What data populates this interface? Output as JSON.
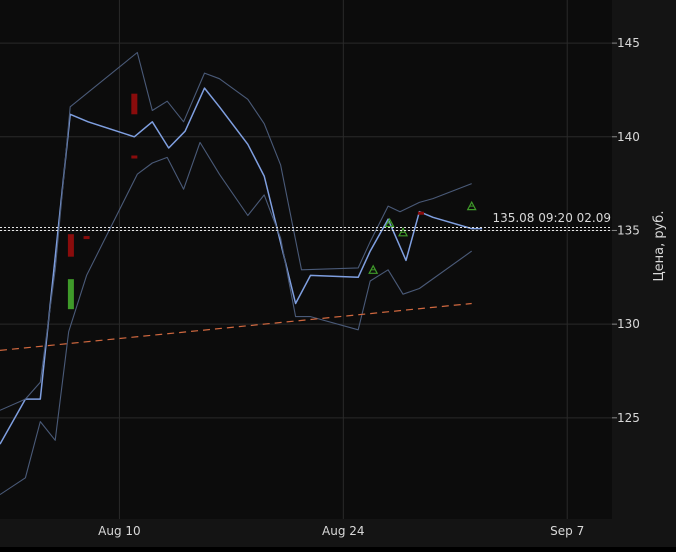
{
  "chart_data": {
    "type": "line",
    "ylabel": "Цена, руб.",
    "xlabel": "",
    "title": "",
    "x_unit": "day (2024-07-28 = 0)",
    "xlim": [
      -0.5,
      40.5
    ],
    "ylim": [
      119.6,
      147.3
    ],
    "x_ticks": [
      {
        "x": 7.5,
        "label": "Aug 10"
      },
      {
        "x": 22.5,
        "label": "Aug 24"
      },
      {
        "x": 37.5,
        "label": "Sep 7"
      }
    ],
    "y_ticks": [
      125,
      130,
      135,
      140,
      145
    ],
    "grid": true,
    "last_price": {
      "value": 135.08,
      "label": "135.08 09:20 02.09"
    },
    "colors": {
      "background": "#0a0a0a",
      "plot": "#0c0c0c",
      "axis_panel": "#141414",
      "grid": "#2a2a2a",
      "line": "#7f9fe0",
      "band": "#4a5a78",
      "trend": "#d0683f",
      "up_candle": "#3f9a2a",
      "down_candle": "#8a0c0c",
      "marker": "#3f9a2a",
      "text": "#d8d8d8"
    },
    "series": [
      {
        "role": "price",
        "x": [
          -0.5,
          1.2,
          2.2,
          4.2,
          5.4,
          8.5,
          9.7,
          10.8,
          11.9,
          13.2,
          14.2,
          16.1,
          17.2,
          19.3,
          20.3,
          23.5,
          24.3,
          25.5,
          26.7,
          27.6,
          28.5,
          31.1,
          31.8
        ],
        "y": [
          123.6,
          126,
          126,
          141.2,
          140.8,
          140,
          140.8,
          139.4,
          140.3,
          142.6,
          141.6,
          139.6,
          137.9,
          131.1,
          132.6,
          132.5,
          133.9,
          135.6,
          133.4,
          136,
          135.7,
          135.1,
          135.1
        ]
      },
      {
        "role": "upper-band",
        "x": [
          -0.5,
          1.2,
          2.2,
          3.2,
          4.2,
          8.7,
          9.7,
          10.7,
          11.8,
          13.2,
          14.2,
          16.1,
          17.2,
          18.3,
          19.7,
          23.5,
          24.3,
          25.5,
          26.3,
          27.6,
          28.5,
          31.1
        ],
        "y": [
          125.4,
          126,
          126.9,
          132.9,
          141.6,
          144.5,
          141.4,
          141.9,
          140.8,
          143.4,
          143.1,
          142,
          140.7,
          138.5,
          132.9,
          133,
          134.4,
          136.3,
          136,
          136.5,
          136.7,
          137.5
        ]
      },
      {
        "role": "lower-band",
        "x": [
          -0.5,
          1.2,
          2.2,
          3.2,
          4.1,
          5.3,
          8.7,
          9.7,
          10.7,
          11.8,
          12.9,
          14.2,
          16.1,
          17.2,
          18.3,
          19.3,
          20.3,
          23.5,
          24.3,
          25.5,
          26.5,
          27.6,
          31.1
        ],
        "y": [
          120.9,
          121.8,
          124.8,
          123.8,
          129.6,
          132.6,
          138,
          138.6,
          138.9,
          137.2,
          139.7,
          138,
          135.8,
          136.9,
          134.6,
          130.4,
          130.4,
          129.7,
          132.3,
          132.9,
          131.6,
          131.9,
          133.9
        ]
      },
      {
        "role": "trend",
        "x": [
          -0.5,
          31.1
        ],
        "y": [
          128.6,
          131.1
        ]
      }
    ],
    "candles": [
      {
        "x": 4.25,
        "open": 132.4,
        "close": 130.8,
        "dir": "up"
      },
      {
        "x": 4.25,
        "open": 134.8,
        "close": 133.6,
        "dir": "down"
      },
      {
        "x": 5.3,
        "open": 134.7,
        "close": 134.6,
        "dir": "down"
      },
      {
        "x": 8.5,
        "open": 142.3,
        "close": 141.2,
        "dir": "down"
      },
      {
        "x": 8.5,
        "open": 139,
        "close": 138.9,
        "dir": "down"
      },
      {
        "x": 27.7,
        "open": 136,
        "close": 135.9,
        "dir": "down"
      }
    ],
    "markers": [
      {
        "x": 24.5,
        "y": 132.9
      },
      {
        "x": 25.6,
        "y": 135.4
      },
      {
        "x": 26.5,
        "y": 134.9
      },
      {
        "x": 31.1,
        "y": 136.3
      }
    ]
  }
}
